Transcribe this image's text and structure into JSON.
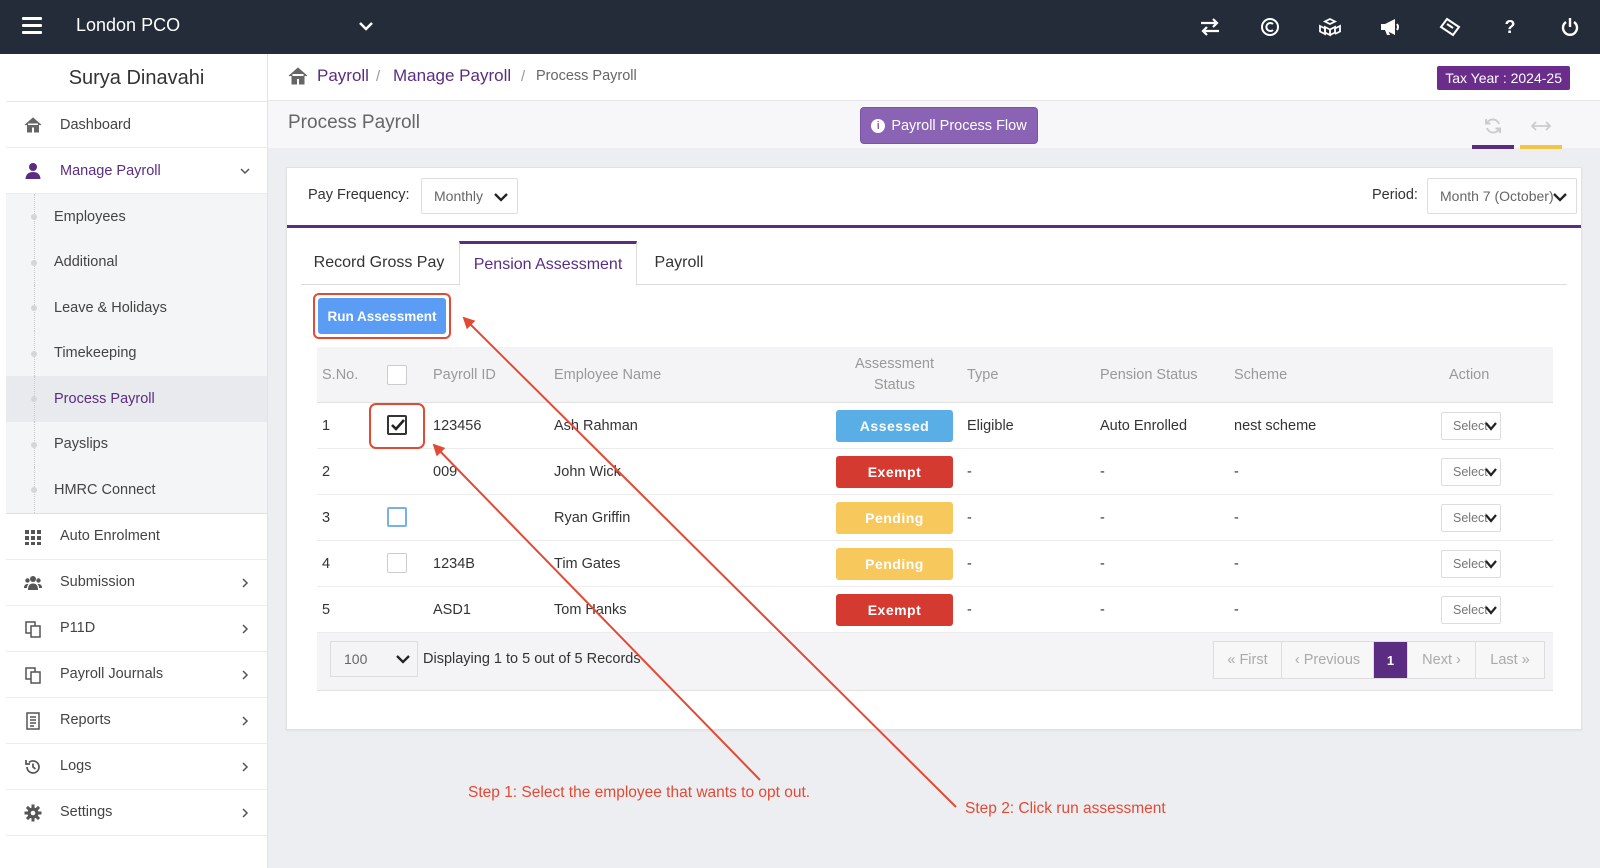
{
  "header": {
    "app_title": "London PCO",
    "icons": [
      "swap-icon",
      "currency-icon",
      "cubes-icon",
      "megaphone-icon",
      "ticket-icon",
      "help-icon",
      "power-icon"
    ],
    "help_glyph": "?"
  },
  "sidebar": {
    "user_name": "Surya Dinavahi",
    "items": {
      "dashboard": "Dashboard",
      "manage_payroll": "Manage Payroll",
      "auto_enrolment": "Auto Enrolment",
      "submission": "Submission",
      "p11d": "P11D",
      "payroll_journals": "Payroll Journals",
      "reports": "Reports",
      "logs": "Logs",
      "settings": "Settings"
    },
    "sub_items": [
      "Employees",
      "Additional",
      "Leave & Holidays",
      "Timekeeping",
      "Process Payroll",
      "Payslips",
      "HMRC Connect"
    ],
    "active_sub": "Process Payroll"
  },
  "breadcrumb": {
    "items": [
      "Payroll",
      "Manage Payroll",
      "Process Payroll"
    ],
    "separator": "/",
    "tax_year": "Tax Year : 2024-25"
  },
  "page": {
    "title": "Process Payroll",
    "flow_button": "Payroll Process Flow",
    "info_glyph": "i"
  },
  "filters": {
    "pay_frequency_label": "Pay Frequency:",
    "pay_frequency_value": "Monthly",
    "period_label": "Period:",
    "period_value": "Month 7 (October)"
  },
  "tabs": {
    "record_gross_pay": "Record Gross Pay",
    "pension_assessment": "Pension Assessment",
    "payroll": "Payroll",
    "active": "Pension Assessment"
  },
  "run_button": "Run Assessment",
  "table": {
    "columns": {
      "sno": "S.No.",
      "payroll_id": "Payroll ID",
      "employee_name": "Employee Name",
      "assessment_status_1": "Assessment",
      "assessment_status_2": "Status",
      "type": "Type",
      "pension_status": "Pension Status",
      "scheme": "Scheme",
      "action": "Action"
    },
    "rows": [
      {
        "sno": "1",
        "checked": true,
        "payroll_id": "123456",
        "name": "Ash Rahman",
        "status": "Assessed",
        "type": "Eligible",
        "pension_status": "Auto Enrolled",
        "scheme": "nest scheme",
        "action": "Select"
      },
      {
        "sno": "2",
        "payroll_id": "009",
        "name": "John Wick",
        "status": "Exempt",
        "type": "-",
        "pension_status": "-",
        "scheme": "-",
        "action": "Select"
      },
      {
        "sno": "3",
        "payroll_id": "",
        "name": "Ryan Griffin",
        "status": "Pending",
        "type": "-",
        "pension_status": "-",
        "scheme": "-",
        "action": "Select"
      },
      {
        "sno": "4",
        "payroll_id": "1234B",
        "name": "Tim Gates",
        "status": "Pending",
        "type": "-",
        "pension_status": "-",
        "scheme": "-",
        "action": "Select"
      },
      {
        "sno": "5",
        "payroll_id": "ASD1",
        "name": "Tom Hanks",
        "status": "Exempt",
        "type": "-",
        "pension_status": "-",
        "scheme": "-",
        "action": "Select"
      }
    ],
    "per_page": "100",
    "records_text": "Displaying 1 to 5 out of 5 Records",
    "pagination": {
      "first": "« First",
      "previous": "‹ Previous",
      "current": "1",
      "next": "Next ›",
      "last": "Last »"
    }
  },
  "status_colors": {
    "Assessed": "#5aaee6",
    "Exempt": "#d43a30",
    "Pending": "#f7c85b"
  },
  "accent_color": "#5a2d82",
  "annotations": {
    "step1": "Step 1: Select the employee that wants to opt out.",
    "step2": "Step 2: Click run assessment",
    "color": "#e24a36"
  }
}
